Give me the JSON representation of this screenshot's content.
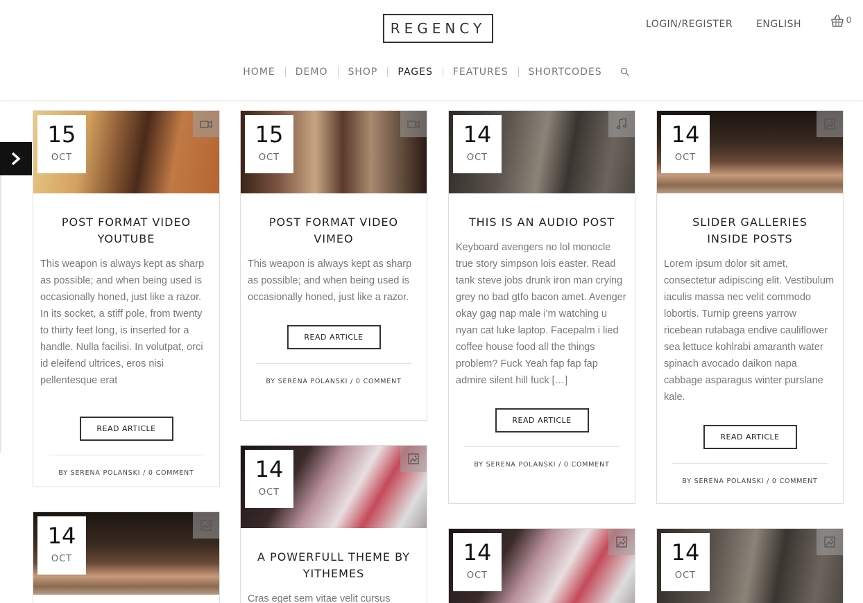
{
  "header": {
    "logo": "REGENCY",
    "login": "LOGIN/REGISTER",
    "language": "ENGLISH",
    "cart_count": "0"
  },
  "nav": {
    "items": [
      {
        "label": "HOME"
      },
      {
        "label": "DEMO"
      },
      {
        "label": "SHOP"
      },
      {
        "label": "PAGES",
        "active": true
      },
      {
        "label": "FEATURES"
      },
      {
        "label": "SHORTCODES"
      }
    ]
  },
  "posts": [
    {
      "day": "15",
      "month": "OCT",
      "format_icon": "video-camera-icon",
      "title": "POST FORMAT VIDEO YOUTUBE",
      "excerpt": "This weapon is always kept as sharp as possible; and when being used is occasionally honed, just like a razor. In its socket, a stiff pole, from twenty to thirty feet long, is inserted for a handle. Nulla facilisi. In volutpat, orci id eleifend ultrices, eros nisi pellentesque erat",
      "button": "READ ARTICLE",
      "meta": "BY SERENA POLANSKI / 0 COMMENT"
    },
    {
      "day": "15",
      "month": "OCT",
      "format_icon": "video-camera-icon",
      "title": "POST FORMAT VIDEO VIMEO",
      "excerpt": "This weapon is always kept as sharp as possible; and when being used is occasionally honed, just like a razor.",
      "button": "READ ARTICLE",
      "meta": "BY SERENA POLANSKI / 0 COMMENT"
    },
    {
      "day": "14",
      "month": "OCT",
      "format_icon": "music-note-icon",
      "title": "THIS IS AN AUDIO POST",
      "excerpt": "Keyboard avengers no lol monocle true story simpson lois easter. Read tank steve jobs drunk iron man crying grey no bad gtfo bacon amet. Avenger okay gag nap male i'm watching u nyan cat luke laptop. Facepalm i lied coffee house food all the things problem? Fuck Yeah fap fap fap admire silent hill fuck […]",
      "button": "READ ARTICLE",
      "meta": "BY SERENA POLANSKI / 0 COMMENT"
    },
    {
      "day": "14",
      "month": "OCT",
      "format_icon": "gallery-icon",
      "title": "SLIDER GALLERIES INSIDE POSTS",
      "excerpt": "Lorem ipsum dolor sit amet, consectetur adipiscing elit. Vestibulum iaculis massa nec velit commodo lobortis. Turnip greens yarrow ricebean rutabaga endive cauliflower sea lettuce kohlrabi amaranth water spinach avocado daikon napa cabbage asparagus winter purslane kale.",
      "button": "READ ARTICLE",
      "meta": "BY SERENA POLANSKI / 0 COMMENT"
    },
    {
      "day": "14",
      "month": "OCT",
      "format_icon": "gallery-icon",
      "title": "A POWERFULL THEME BY YITHEMES",
      "excerpt": "Cras eget sem vitae velit cursus"
    },
    {
      "day": "14",
      "month": "OCT",
      "format_icon": "gallery-icon"
    },
    {
      "day": "14",
      "month": "OCT",
      "format_icon": "gallery-icon"
    },
    {
      "day": "14",
      "month": "OCT",
      "format_icon": "gallery-icon"
    }
  ]
}
